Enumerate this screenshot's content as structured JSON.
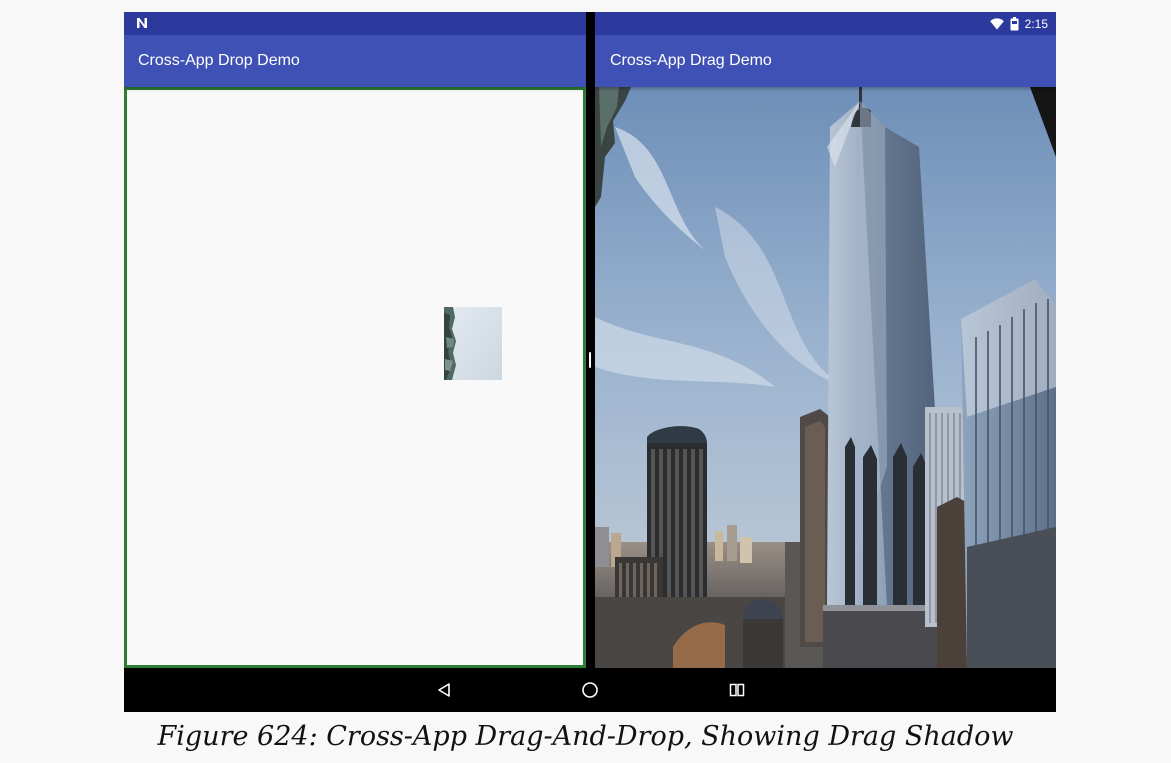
{
  "status_bar": {
    "left_icon": "android-n-notification-icon",
    "wifi_icon": "wifi-icon",
    "battery_icon": "battery-icon",
    "time": "2:15"
  },
  "left_app": {
    "title": "Cross-App Drop Demo",
    "drop_zone_border_color": "#2e7d32"
  },
  "right_app": {
    "title": "Cross-App Drag Demo"
  },
  "nav_bar": {
    "back_icon": "back-triangle-icon",
    "home_icon": "home-circle-icon",
    "recents_icon": "recents-square-icon"
  },
  "colors": {
    "app_bar": "#3f51b5",
    "status_bar": "#2b3a9c",
    "page_background": "#f8f8f8"
  },
  "caption": "Figure 624: Cross-App Drag-And-Drop, Showing Drag Shadow"
}
